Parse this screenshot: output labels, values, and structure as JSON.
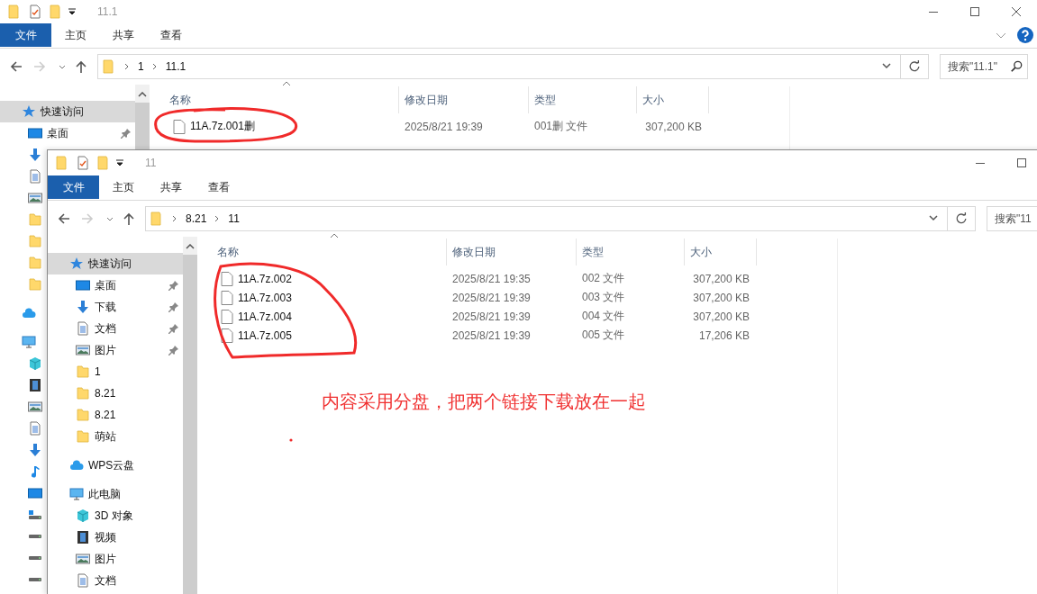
{
  "windows": [
    {
      "title": "11.1",
      "ribbon_tabs": [
        {
          "label": "文件",
          "kind": "file"
        },
        {
          "label": "主页",
          "kind": "tab"
        },
        {
          "label": "共享",
          "kind": "tab"
        },
        {
          "label": "查看",
          "kind": "tab"
        }
      ],
      "nav": {
        "back_enabled": true,
        "forward_enabled": false
      },
      "path": [
        "1",
        "11.1"
      ],
      "search": {
        "placeholder": "搜索\"11.1\""
      },
      "sidebar": [
        {
          "kind": "star",
          "label": "快速访问",
          "selected": true,
          "children": [
            {
              "kind": "desktop",
              "label": "桌面",
              "selected": false,
              "pinned": true
            },
            {
              "kind": "downloads"
            },
            {
              "kind": "documents"
            },
            {
              "kind": "pictures"
            },
            {
              "kind": "folder"
            },
            {
              "kind": "folder"
            },
            {
              "kind": "folder"
            },
            {
              "kind": "folder"
            }
          ]
        },
        {
          "kind": "cloud"
        },
        {
          "kind": "computer",
          "children": [
            {
              "kind": "objects"
            },
            {
              "kind": "video"
            },
            {
              "kind": "pictures"
            },
            {
              "kind": "documents"
            },
            {
              "kind": "downloads"
            },
            {
              "kind": "music"
            },
            {
              "kind": "desktop"
            },
            {
              "kind": "windrive"
            },
            {
              "kind": "drive"
            },
            {
              "kind": "drive"
            },
            {
              "kind": "drive"
            }
          ]
        }
      ],
      "columns": [
        {
          "label": "名称",
          "sorted": true
        },
        {
          "label": "修改日期",
          "sorted": false
        },
        {
          "label": "类型",
          "sorted": false
        },
        {
          "label": "大小",
          "sorted": false
        }
      ],
      "rows": [
        {
          "name": "11A.7z.001删",
          "modified": "2025/8/21 19:39",
          "type": "001删 文件",
          "size": "307,200 KB"
        }
      ]
    },
    {
      "title": "11",
      "ribbon_tabs": [
        {
          "label": "文件",
          "kind": "file"
        },
        {
          "label": "主页",
          "kind": "tab"
        },
        {
          "label": "共享",
          "kind": "tab"
        },
        {
          "label": "查看",
          "kind": "tab"
        }
      ],
      "nav": {
        "back_enabled": true,
        "forward_enabled": false
      },
      "path": [
        "8.21",
        "11"
      ],
      "search": {
        "placeholder": "搜索\"11"
      },
      "sidebar": [
        {
          "kind": "star",
          "label": "快速访问",
          "selected": true,
          "children": [
            {
              "kind": "desktop",
              "label": "桌面",
              "selected": false,
              "pinned": true
            },
            {
              "kind": "downloads",
              "label": "下载",
              "selected": false,
              "pinned": true
            },
            {
              "kind": "documents",
              "label": "文档",
              "selected": false,
              "pinned": true
            },
            {
              "kind": "pictures",
              "label": "图片",
              "selected": false,
              "pinned": true
            },
            {
              "kind": "folder",
              "label": "1",
              "selected": false,
              "pinned": false
            },
            {
              "kind": "folder",
              "label": "8.21",
              "selected": false,
              "pinned": false
            },
            {
              "kind": "folder",
              "label": "8.21",
              "selected": false,
              "pinned": false
            },
            {
              "kind": "folder",
              "label": "萌站",
              "selected": false,
              "pinned": false
            }
          ]
        },
        {
          "kind": "cloud",
          "label": "WPS云盘",
          "selected": false
        },
        {
          "kind": "computer",
          "label": "此电脑",
          "selected": false,
          "children": [
            {
              "kind": "objects",
              "label": "3D 对象",
              "selected": false,
              "pinned": false
            },
            {
              "kind": "video",
              "label": "视频",
              "selected": false,
              "pinned": false
            },
            {
              "kind": "pictures",
              "label": "图片",
              "selected": false,
              "pinned": false
            },
            {
              "kind": "documents",
              "label": "文档",
              "selected": false,
              "pinned": false
            }
          ]
        }
      ],
      "columns": [
        {
          "label": "名称",
          "sorted": true
        },
        {
          "label": "修改日期",
          "sorted": false
        },
        {
          "label": "类型",
          "sorted": false
        },
        {
          "label": "大小",
          "sorted": false
        }
      ],
      "rows": [
        {
          "name": "11A.7z.002",
          "modified": "2025/8/21 19:35",
          "type": "002 文件",
          "size": "307,200 KB"
        },
        {
          "name": "11A.7z.003",
          "modified": "2025/8/21 19:39",
          "type": "003 文件",
          "size": "307,200 KB"
        },
        {
          "name": "11A.7z.004",
          "modified": "2025/8/21 19:39",
          "type": "004 文件",
          "size": "307,200 KB"
        },
        {
          "name": "11A.7z.005",
          "modified": "2025/8/21 19:39",
          "type": "005 文件",
          "size": "17,206 KB"
        }
      ]
    }
  ],
  "annotation": {
    "note": "内容采用分盘，把两个链接下载放在一起"
  }
}
